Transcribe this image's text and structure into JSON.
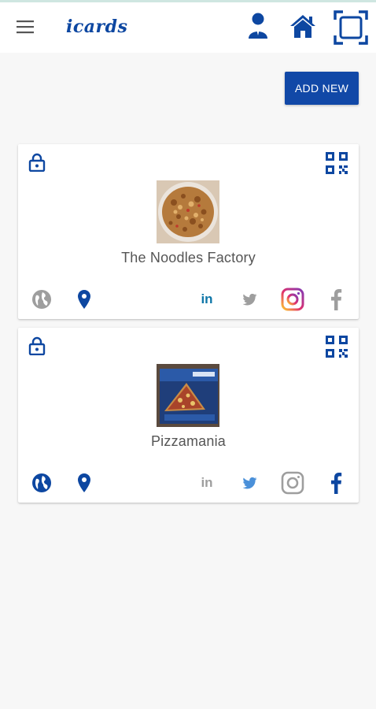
{
  "app": {
    "brand": "icards",
    "icons": [
      "menu-icon",
      "user-icon",
      "home-icon",
      "scan-icon"
    ],
    "accent_color": "#0d47a1"
  },
  "toolbar": {
    "add_new_label": "ADD NEW"
  },
  "cards": [
    {
      "title": "The Noodles Factory",
      "image_desc_icon": "noodles-photo",
      "social": {
        "website": "inactive",
        "location": "active",
        "linkedin": "active",
        "twitter": "inactive",
        "instagram": "active",
        "facebook": "inactive"
      }
    },
    {
      "title": "Pizzamania",
      "image_desc_icon": "pizza-photo",
      "social": {
        "website": "active",
        "location": "active",
        "linkedin": "inactive",
        "twitter": "active",
        "instagram": "inactive",
        "facebook": "active"
      }
    }
  ],
  "colors": {
    "primary": "#0d47a1",
    "inactive": "#9e9e9e",
    "twitter": "#4a90d9",
    "linkedin": "#0e76a8"
  }
}
